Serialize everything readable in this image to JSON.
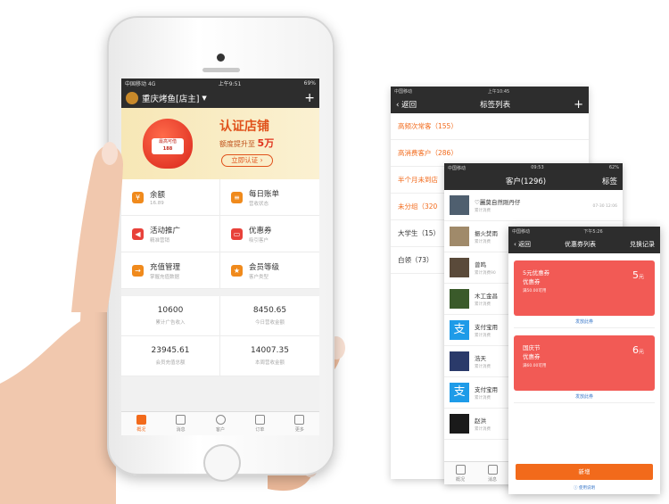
{
  "main_phone": {
    "status": {
      "carrier": "中国移动",
      "network": "4G",
      "time": "上午9:51",
      "battery": "69%"
    },
    "title": "重庆烤鱼[店主]",
    "banner": {
      "headline": "认证店铺",
      "sub_prefix": "额度提升至",
      "sub_amount": "5万",
      "button": "立即认证",
      "bag_top": "最高可借",
      "bag_amount": "188"
    },
    "menu": [
      {
        "label": "余额",
        "sub": "16.89"
      },
      {
        "label": "每日账单",
        "sub": "营收状态"
      },
      {
        "label": "活动推广",
        "sub": "精准营销"
      },
      {
        "label": "优惠券",
        "sub": "吸引客户"
      },
      {
        "label": "充值管理",
        "sub": "掌握充值数据"
      },
      {
        "label": "会员等级",
        "sub": "客户类型"
      }
    ],
    "stats": [
      {
        "value": "10600",
        "label": "累计广告收入"
      },
      {
        "value": "8450.65",
        "label": "今日营收金额"
      },
      {
        "value": "23945.61",
        "label": "会员充值总额"
      },
      {
        "value": "14007.35",
        "label": "本周营收金额"
      }
    ],
    "tabs": [
      "概况",
      "消息",
      "客户",
      "订单",
      "更多"
    ]
  },
  "screen_tags": {
    "status": {
      "carrier": "中国移动",
      "time": "上午10:45"
    },
    "back": "返回",
    "title": "标签列表",
    "rows": [
      {
        "label": "高频次常客（155）"
      },
      {
        "label": "高消费客户（286）"
      },
      {
        "label": "半个月未到店"
      },
      {
        "label": "未分组（320"
      },
      {
        "label": "大学生（15）"
      },
      {
        "label": "白领（73）"
      }
    ]
  },
  "screen_customers": {
    "status": {
      "carrier": "中国移动",
      "time": "09:53",
      "battery": "62%"
    },
    "title": "客户(1296)",
    "right": "标签",
    "rows": [
      {
        "name": "♡麗莫自然刚丹仔",
        "sub": "累计消费",
        "date": "07-30 12:06"
      },
      {
        "name": "振火焚雨",
        "sub": "累计消费"
      },
      {
        "name": "曾鸣",
        "sub": "累计消费90"
      },
      {
        "name": "木工金昌",
        "sub": "累计消费"
      },
      {
        "name": "支付宝用",
        "sub": "累计消费"
      },
      {
        "name": "浩天",
        "sub": "累计消费"
      },
      {
        "name": "支付宝用",
        "sub": "累计消费"
      },
      {
        "name": "赵洪",
        "sub": "累计消费"
      }
    ],
    "tabs": [
      "概况",
      "消息"
    ]
  },
  "screen_coupons": {
    "status": {
      "carrier": "中国移动",
      "time": "下午5:26"
    },
    "back": "返回",
    "title": "优惠券列表",
    "right": "兑换记录",
    "coupons": [
      {
        "title": "5元优惠券",
        "type": "优惠券",
        "value": "5",
        "unit": "元",
        "sub": "满50.00可用",
        "link": "发放此券"
      },
      {
        "title": "国庆节",
        "type": "优惠券",
        "value": "6",
        "unit": "元",
        "sub": "满60.00可用",
        "link": "发放此券"
      }
    ],
    "new_button": "新增",
    "help": "使用说明"
  }
}
